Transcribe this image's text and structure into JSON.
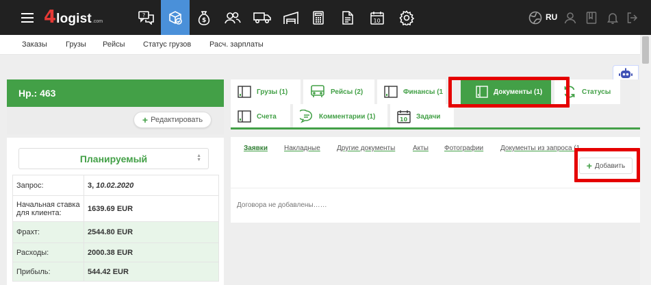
{
  "app": {
    "logo_prefix": "4",
    "logo_text": "logist",
    "logo_suffix": ".com",
    "lang": "RU"
  },
  "topnav": {
    "icons": [
      "menu-icon",
      "chat-icon",
      "cargo-icon",
      "money-bag-icon",
      "contacts-icon",
      "truck-icon",
      "warehouse-icon",
      "calculator-icon",
      "document-icon",
      "calendar-icon",
      "gear-icon"
    ],
    "calendar_num": "10",
    "right_icons": [
      "globe-icon",
      "user-icon",
      "book-icon",
      "bell-icon",
      "logout-icon"
    ]
  },
  "subnav": {
    "items": [
      "Заказы",
      "Грузы",
      "Рейсы",
      "Статус грузов",
      "Расч. зарплаты"
    ]
  },
  "order": {
    "title": "Нр.: 463",
    "edit_label": "Редактировать",
    "status": "Планируемый",
    "rows": [
      {
        "label": "Запрос:",
        "value_plain": "3, ",
        "value_italic": "10.02.2020"
      },
      {
        "label": "Начальная ставка для клиента:",
        "value": "1639.69 EUR"
      },
      {
        "label": "Фрахт:",
        "value": "2544.80 EUR"
      },
      {
        "label": "Расходы:",
        "value": "2000.38 EUR"
      },
      {
        "label": "Прибыль:",
        "value": "544.42 EUR"
      }
    ]
  },
  "tabs": [
    {
      "label": "Грузы (1)"
    },
    {
      "label": "Рейсы (2)"
    },
    {
      "label": "Финансы (1"
    },
    {
      "label": "Документы (1)"
    },
    {
      "label": "Статусы"
    },
    {
      "label": "Счета"
    },
    {
      "label": "Комментарии (1)"
    },
    {
      "label": "Задачи"
    }
  ],
  "subtabs": [
    {
      "label": "Заявки"
    },
    {
      "label": "Накладные"
    },
    {
      "label": "Другие документы"
    },
    {
      "label": "Акты"
    },
    {
      "label": "Фотографии"
    },
    {
      "label": "Документы из запроса (1"
    }
  ],
  "documents": {
    "add_label": "Добавить",
    "empty_text": "Договора не добавлены……"
  },
  "colors": {
    "accent": "#43a047",
    "topbar": "#212121",
    "active_nav": "#4a90d9",
    "highlight": "#e50000"
  }
}
